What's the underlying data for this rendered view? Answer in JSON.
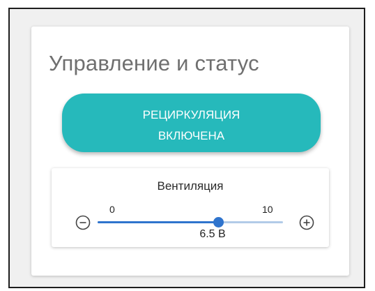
{
  "card": {
    "title": "Управление и статус"
  },
  "recirculation_button": {
    "line1": "РЕЦИРКУЛЯЦИЯ",
    "line2": "ВКЛЮЧЕНА",
    "color": "#26b9bb"
  },
  "ventilation": {
    "title": "Вентиляция",
    "min": 0,
    "max": 10,
    "value": 6.5,
    "value_label": "6.5 В",
    "minus_icon": "minus-circle-icon",
    "plus_icon": "plus-circle-icon",
    "track_color": "#b2cbe8",
    "fill_color": "#2f74cd"
  }
}
